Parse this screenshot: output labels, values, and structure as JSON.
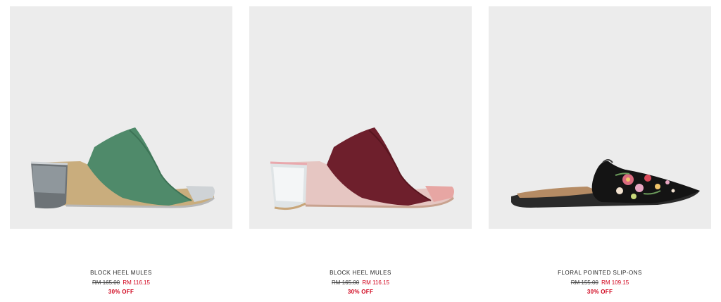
{
  "products": [
    {
      "name": "BLOCK HEEL MULES",
      "old_price": "RM 165.00",
      "new_price": "RM 116.15",
      "discount": "30% OFF",
      "color": "#4f8a6a"
    },
    {
      "name": "BLOCK HEEL MULES",
      "old_price": "RM 165.00",
      "new_price": "RM 116.15",
      "discount": "30% OFF",
      "color": "#6e1f2c"
    },
    {
      "name": "FLORAL POINTED SLIP-ONS",
      "old_price": "RM 155.00",
      "new_price": "RM 109.15",
      "discount": "30% OFF",
      "color": "#141414"
    }
  ]
}
